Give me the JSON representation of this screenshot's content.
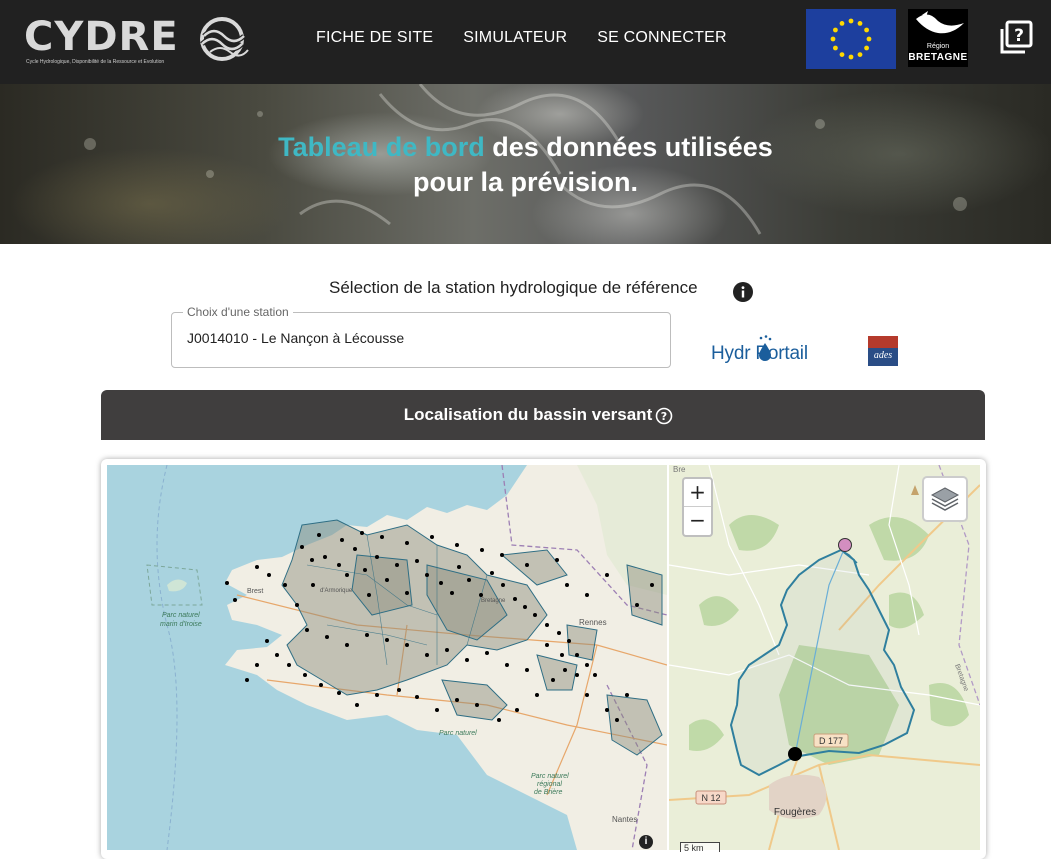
{
  "header": {
    "brand": "CYDRE",
    "tagline": "Cycle Hydrologique, Disponibilité de la Ressource et Evolution",
    "nav": [
      "FICHE DE SITE",
      "SIMULATEUR",
      "SE CONNECTER"
    ],
    "region_small": "Région",
    "region_name": "BRETAGNE",
    "icons": {
      "help": "help-square-icon",
      "eu": "eu-flag-icon"
    },
    "colors": {
      "bar": "#212121",
      "accent": "#3fb8c4",
      "eu_blue": "#1d3f9e",
      "eu_star": "#ffd800"
    }
  },
  "hero": {
    "title_accent": "Tableau de bord",
    "title_rest": " des données utilisées",
    "title_line2": "pour la prévision."
  },
  "station": {
    "label": "Sélection de la station hydrologique de référence",
    "field_label": "Choix d'une station",
    "value": "J0014010 - Le Nançon à Lécousse",
    "hydroportail": "Hydr  Portail",
    "ades": "ades"
  },
  "section": {
    "title": "Localisation du bassin versant",
    "colors": {
      "bar": "#403e3e"
    }
  },
  "map_left": {
    "labels": {
      "brest": "Brest",
      "parc_iroise_1": "Parc naturel",
      "parc_iroise_2": "marin d'Iroise",
      "rennes": "Rennes",
      "nantes": "Nantes",
      "parc_briere_1": "Parc naturel",
      "parc_briere_2": "régional",
      "parc_briere_3": "de Brière",
      "parc_golfe": "Parc naturel",
      "bretagne": "Bretagne",
      "armorique": "d'Armorique"
    },
    "attribution_icon": "info-icon"
  },
  "map_right": {
    "zoom_in": "+",
    "zoom_out": "−",
    "road_d177": "D 177",
    "road_n12": "N 12",
    "town": "Fougères",
    "scale": "5 km",
    "edge_label": "Bre",
    "side_label": "Bretagne",
    "layers_icon": "layers-icon"
  }
}
